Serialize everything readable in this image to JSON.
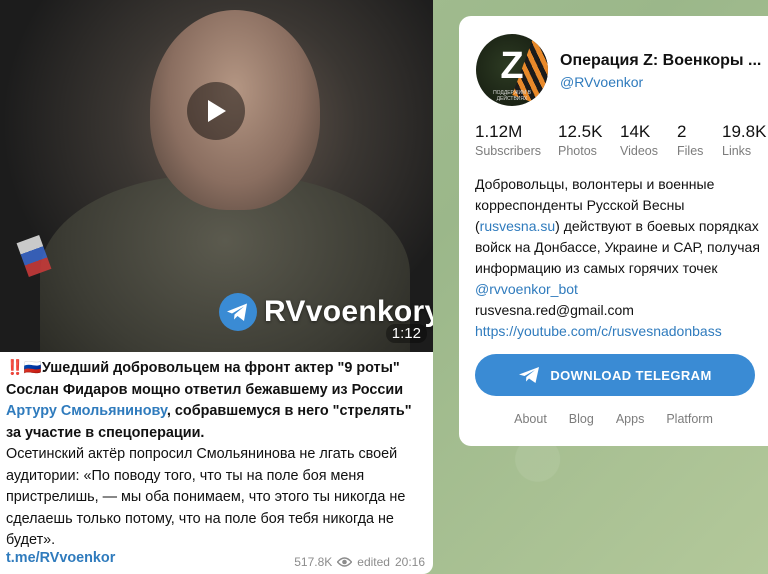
{
  "post": {
    "video": {
      "watermark_text": "RVvoenkory",
      "duration": "1:12"
    },
    "text": {
      "lead_emoji": "‼️🇷🇺",
      "headline_part1": "Ушедший добровольцем на фронт актер \"9 роты\" Сослан Фидаров мощно ответил бежавшему из России ",
      "headline_link": "Артуру Смольянинову",
      "headline_part2": ", собравшемуся в него \"стрелять\" за участие в спецоперации.",
      "body": "Осетинский актёр попросил Смольянинова не лгать своей аудитории: «По поводу того, что ты на поле боя меня пристрелишь, — мы оба понимаем, что этого ты никогда не сделаешь только потому, что на поле боя тебя никогда не будет»."
    },
    "footer_link": "t.me/RVvoenkor",
    "views": "517.8K",
    "edited_label": "edited",
    "time": "20:16"
  },
  "channel": {
    "title": "Операция Z: Военкоры ...",
    "handle": "@RVvoenkor",
    "avatar": {
      "letter": "Z",
      "caption": "ПОДДЕРЖИМ В ДЕЙСТВИЯХ"
    },
    "stats": [
      {
        "value": "1.12M",
        "label": "Subscribers"
      },
      {
        "value": "12.5K",
        "label": "Photos"
      },
      {
        "value": "14K",
        "label": "Videos"
      },
      {
        "value": "2",
        "label": "Files"
      },
      {
        "value": "19.8K",
        "label": "Links"
      }
    ],
    "description": {
      "part1": "Добровольцы, волонтеры и военные корреспонденты Русской Весны (",
      "link1": "rusvesna.su",
      "part2": ") действуют в боевых порядках войск на Донбассе, Украине и САР, получая информацию из самых горячих точек ",
      "link2": "@rvvoenkor_bot",
      "email": "rusvesna.red@gmail.com",
      "link3": "https://youtube.com/c/rusvesnadonbass"
    },
    "download_label": "DOWNLOAD TELEGRAM",
    "nav": [
      "About",
      "Blog",
      "Apps",
      "Platform"
    ]
  },
  "colors": {
    "accent": "#3a8bd4",
    "link": "#2f7bbd",
    "background": "#9fbb8e"
  }
}
